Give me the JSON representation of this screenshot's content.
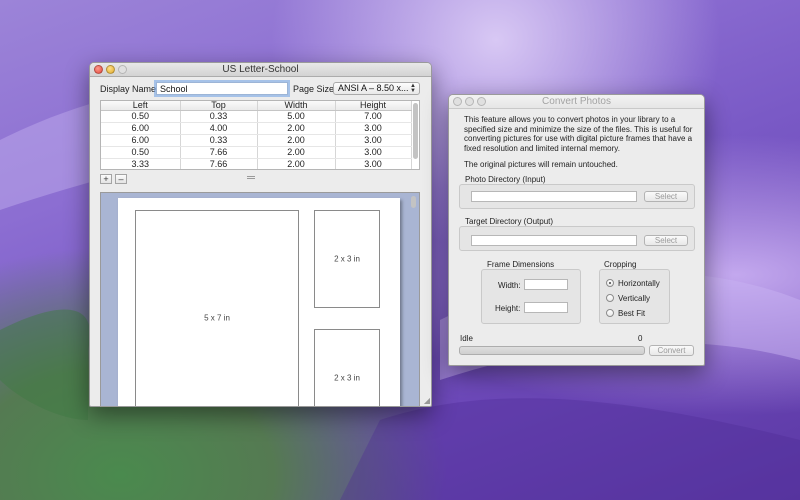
{
  "colors": {
    "accent": "#5a8ee0",
    "canvas_bg": "#a9b5d3"
  },
  "left_window": {
    "title": "US Letter-School",
    "display_name_label": "Display Name:",
    "display_name_value": "School",
    "page_size_label": "Page Size:",
    "page_size_value": "ANSI A – 8.50 x...",
    "table": {
      "columns": [
        "Left",
        "Top",
        "Width",
        "Height"
      ],
      "rows": [
        [
          "0.50",
          "0.33",
          "5.00",
          "7.00"
        ],
        [
          "6.00",
          "4.00",
          "2.00",
          "3.00"
        ],
        [
          "6.00",
          "0.33",
          "2.00",
          "3.00"
        ],
        [
          "0.50",
          "7.66",
          "2.00",
          "3.00"
        ],
        [
          "3.33",
          "7.66",
          "2.00",
          "3.00"
        ]
      ]
    },
    "add_label": "+",
    "remove_label": "–",
    "photos": [
      {
        "label": "5 x 7 in"
      },
      {
        "label": "2 x 3 in"
      },
      {
        "label": "2 x 3 in"
      }
    ]
  },
  "right_window": {
    "title": "Convert Photos",
    "description": "This feature allows you to convert photos in your library to a specified size and minimize the size of the files. This is useful for converting pictures for use with digital picture frames that have a fixed resolution and limited internal memory.",
    "note": "The original pictures will remain untouched.",
    "photo_dir_label": "Photo Directory (Input)",
    "photo_dir_value": "",
    "target_dir_label": "Target Directory (Output)",
    "target_dir_value": "",
    "select_label": "Select",
    "frame_dimensions_label": "Frame Dimensions",
    "width_label": "Width:",
    "width_value": "",
    "height_label": "Height:",
    "height_value": "",
    "cropping_label": "Cropping",
    "cropping_options": [
      "Horizontally",
      "Vertically",
      "Best Fit"
    ],
    "cropping_selected": "Horizontally",
    "status": "Idle",
    "count": "0",
    "progress": 0,
    "convert_label": "Convert"
  }
}
